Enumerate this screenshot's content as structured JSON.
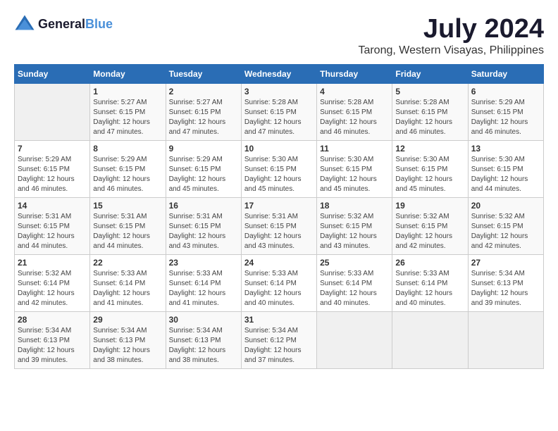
{
  "logo": {
    "line1": "General",
    "line2": "Blue"
  },
  "title": "July 2024",
  "subtitle": "Tarong, Western Visayas, Philippines",
  "days_header": [
    "Sunday",
    "Monday",
    "Tuesday",
    "Wednesday",
    "Thursday",
    "Friday",
    "Saturday"
  ],
  "weeks": [
    [
      {
        "day": "",
        "info": ""
      },
      {
        "day": "1",
        "info": "Sunrise: 5:27 AM\nSunset: 6:15 PM\nDaylight: 12 hours\nand 47 minutes."
      },
      {
        "day": "2",
        "info": "Sunrise: 5:27 AM\nSunset: 6:15 PM\nDaylight: 12 hours\nand 47 minutes."
      },
      {
        "day": "3",
        "info": "Sunrise: 5:28 AM\nSunset: 6:15 PM\nDaylight: 12 hours\nand 47 minutes."
      },
      {
        "day": "4",
        "info": "Sunrise: 5:28 AM\nSunset: 6:15 PM\nDaylight: 12 hours\nand 46 minutes."
      },
      {
        "day": "5",
        "info": "Sunrise: 5:28 AM\nSunset: 6:15 PM\nDaylight: 12 hours\nand 46 minutes."
      },
      {
        "day": "6",
        "info": "Sunrise: 5:29 AM\nSunset: 6:15 PM\nDaylight: 12 hours\nand 46 minutes."
      }
    ],
    [
      {
        "day": "7",
        "info": "Sunrise: 5:29 AM\nSunset: 6:15 PM\nDaylight: 12 hours\nand 46 minutes."
      },
      {
        "day": "8",
        "info": "Sunrise: 5:29 AM\nSunset: 6:15 PM\nDaylight: 12 hours\nand 46 minutes."
      },
      {
        "day": "9",
        "info": "Sunrise: 5:29 AM\nSunset: 6:15 PM\nDaylight: 12 hours\nand 45 minutes."
      },
      {
        "day": "10",
        "info": "Sunrise: 5:30 AM\nSunset: 6:15 PM\nDaylight: 12 hours\nand 45 minutes."
      },
      {
        "day": "11",
        "info": "Sunrise: 5:30 AM\nSunset: 6:15 PM\nDaylight: 12 hours\nand 45 minutes."
      },
      {
        "day": "12",
        "info": "Sunrise: 5:30 AM\nSunset: 6:15 PM\nDaylight: 12 hours\nand 45 minutes."
      },
      {
        "day": "13",
        "info": "Sunrise: 5:30 AM\nSunset: 6:15 PM\nDaylight: 12 hours\nand 44 minutes."
      }
    ],
    [
      {
        "day": "14",
        "info": "Sunrise: 5:31 AM\nSunset: 6:15 PM\nDaylight: 12 hours\nand 44 minutes."
      },
      {
        "day": "15",
        "info": "Sunrise: 5:31 AM\nSunset: 6:15 PM\nDaylight: 12 hours\nand 44 minutes."
      },
      {
        "day": "16",
        "info": "Sunrise: 5:31 AM\nSunset: 6:15 PM\nDaylight: 12 hours\nand 43 minutes."
      },
      {
        "day": "17",
        "info": "Sunrise: 5:31 AM\nSunset: 6:15 PM\nDaylight: 12 hours\nand 43 minutes."
      },
      {
        "day": "18",
        "info": "Sunrise: 5:32 AM\nSunset: 6:15 PM\nDaylight: 12 hours\nand 43 minutes."
      },
      {
        "day": "19",
        "info": "Sunrise: 5:32 AM\nSunset: 6:15 PM\nDaylight: 12 hours\nand 42 minutes."
      },
      {
        "day": "20",
        "info": "Sunrise: 5:32 AM\nSunset: 6:15 PM\nDaylight: 12 hours\nand 42 minutes."
      }
    ],
    [
      {
        "day": "21",
        "info": "Sunrise: 5:32 AM\nSunset: 6:14 PM\nDaylight: 12 hours\nand 42 minutes."
      },
      {
        "day": "22",
        "info": "Sunrise: 5:33 AM\nSunset: 6:14 PM\nDaylight: 12 hours\nand 41 minutes."
      },
      {
        "day": "23",
        "info": "Sunrise: 5:33 AM\nSunset: 6:14 PM\nDaylight: 12 hours\nand 41 minutes."
      },
      {
        "day": "24",
        "info": "Sunrise: 5:33 AM\nSunset: 6:14 PM\nDaylight: 12 hours\nand 40 minutes."
      },
      {
        "day": "25",
        "info": "Sunrise: 5:33 AM\nSunset: 6:14 PM\nDaylight: 12 hours\nand 40 minutes."
      },
      {
        "day": "26",
        "info": "Sunrise: 5:33 AM\nSunset: 6:14 PM\nDaylight: 12 hours\nand 40 minutes."
      },
      {
        "day": "27",
        "info": "Sunrise: 5:34 AM\nSunset: 6:13 PM\nDaylight: 12 hours\nand 39 minutes."
      }
    ],
    [
      {
        "day": "28",
        "info": "Sunrise: 5:34 AM\nSunset: 6:13 PM\nDaylight: 12 hours\nand 39 minutes."
      },
      {
        "day": "29",
        "info": "Sunrise: 5:34 AM\nSunset: 6:13 PM\nDaylight: 12 hours\nand 38 minutes."
      },
      {
        "day": "30",
        "info": "Sunrise: 5:34 AM\nSunset: 6:13 PM\nDaylight: 12 hours\nand 38 minutes."
      },
      {
        "day": "31",
        "info": "Sunrise: 5:34 AM\nSunset: 6:12 PM\nDaylight: 12 hours\nand 37 minutes."
      },
      {
        "day": "",
        "info": ""
      },
      {
        "day": "",
        "info": ""
      },
      {
        "day": "",
        "info": ""
      }
    ]
  ]
}
